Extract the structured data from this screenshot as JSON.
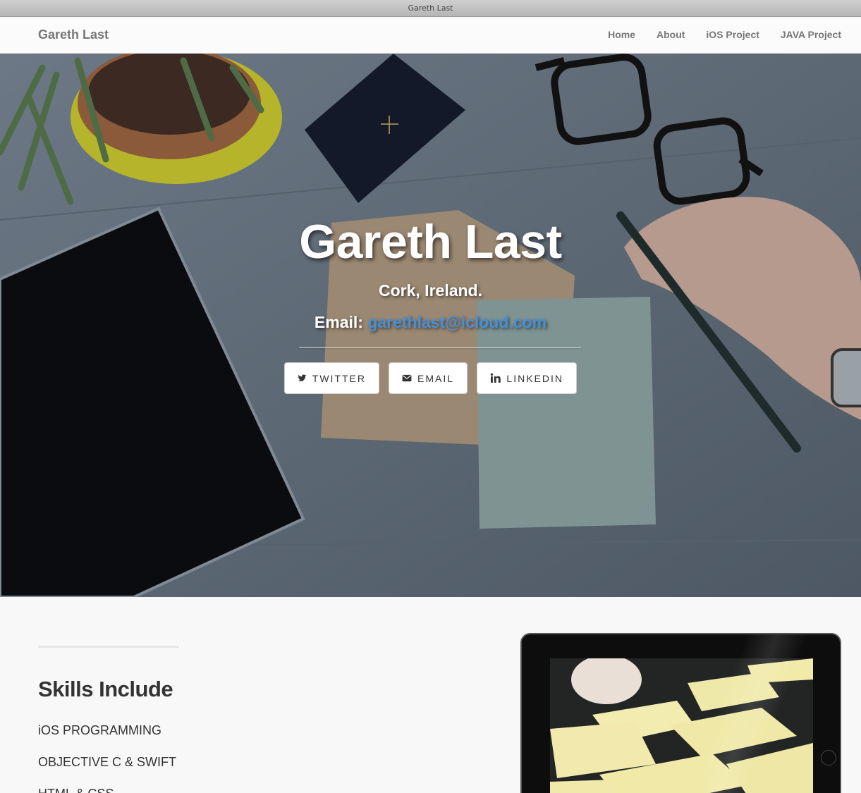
{
  "window": {
    "title": "Gareth Last"
  },
  "navbar": {
    "brand": "Gareth Last",
    "items": [
      {
        "label": "Home"
      },
      {
        "label": "About"
      },
      {
        "label": "iOS Project"
      },
      {
        "label": "JAVA Project"
      }
    ]
  },
  "hero": {
    "title": "Gareth Last",
    "location": "Cork, Ireland.",
    "email_label": "Email:",
    "email_address": "garethlast@icloud.com",
    "buttons": [
      {
        "label": "TWITTER",
        "icon": "twitter-icon"
      },
      {
        "label": "EMAIL",
        "icon": "envelope-icon"
      },
      {
        "label": "LINKEDIN",
        "icon": "linkedin-icon"
      }
    ]
  },
  "skills": {
    "title": "Skills Include",
    "items": [
      "iOS PROGRAMMING",
      "OBJECTIVE C & SWIFT",
      "HTML & CSS"
    ]
  },
  "colors": {
    "link": "#4a8fd4",
    "nav_text": "#777777",
    "hero_overlay": "#5a6673"
  }
}
